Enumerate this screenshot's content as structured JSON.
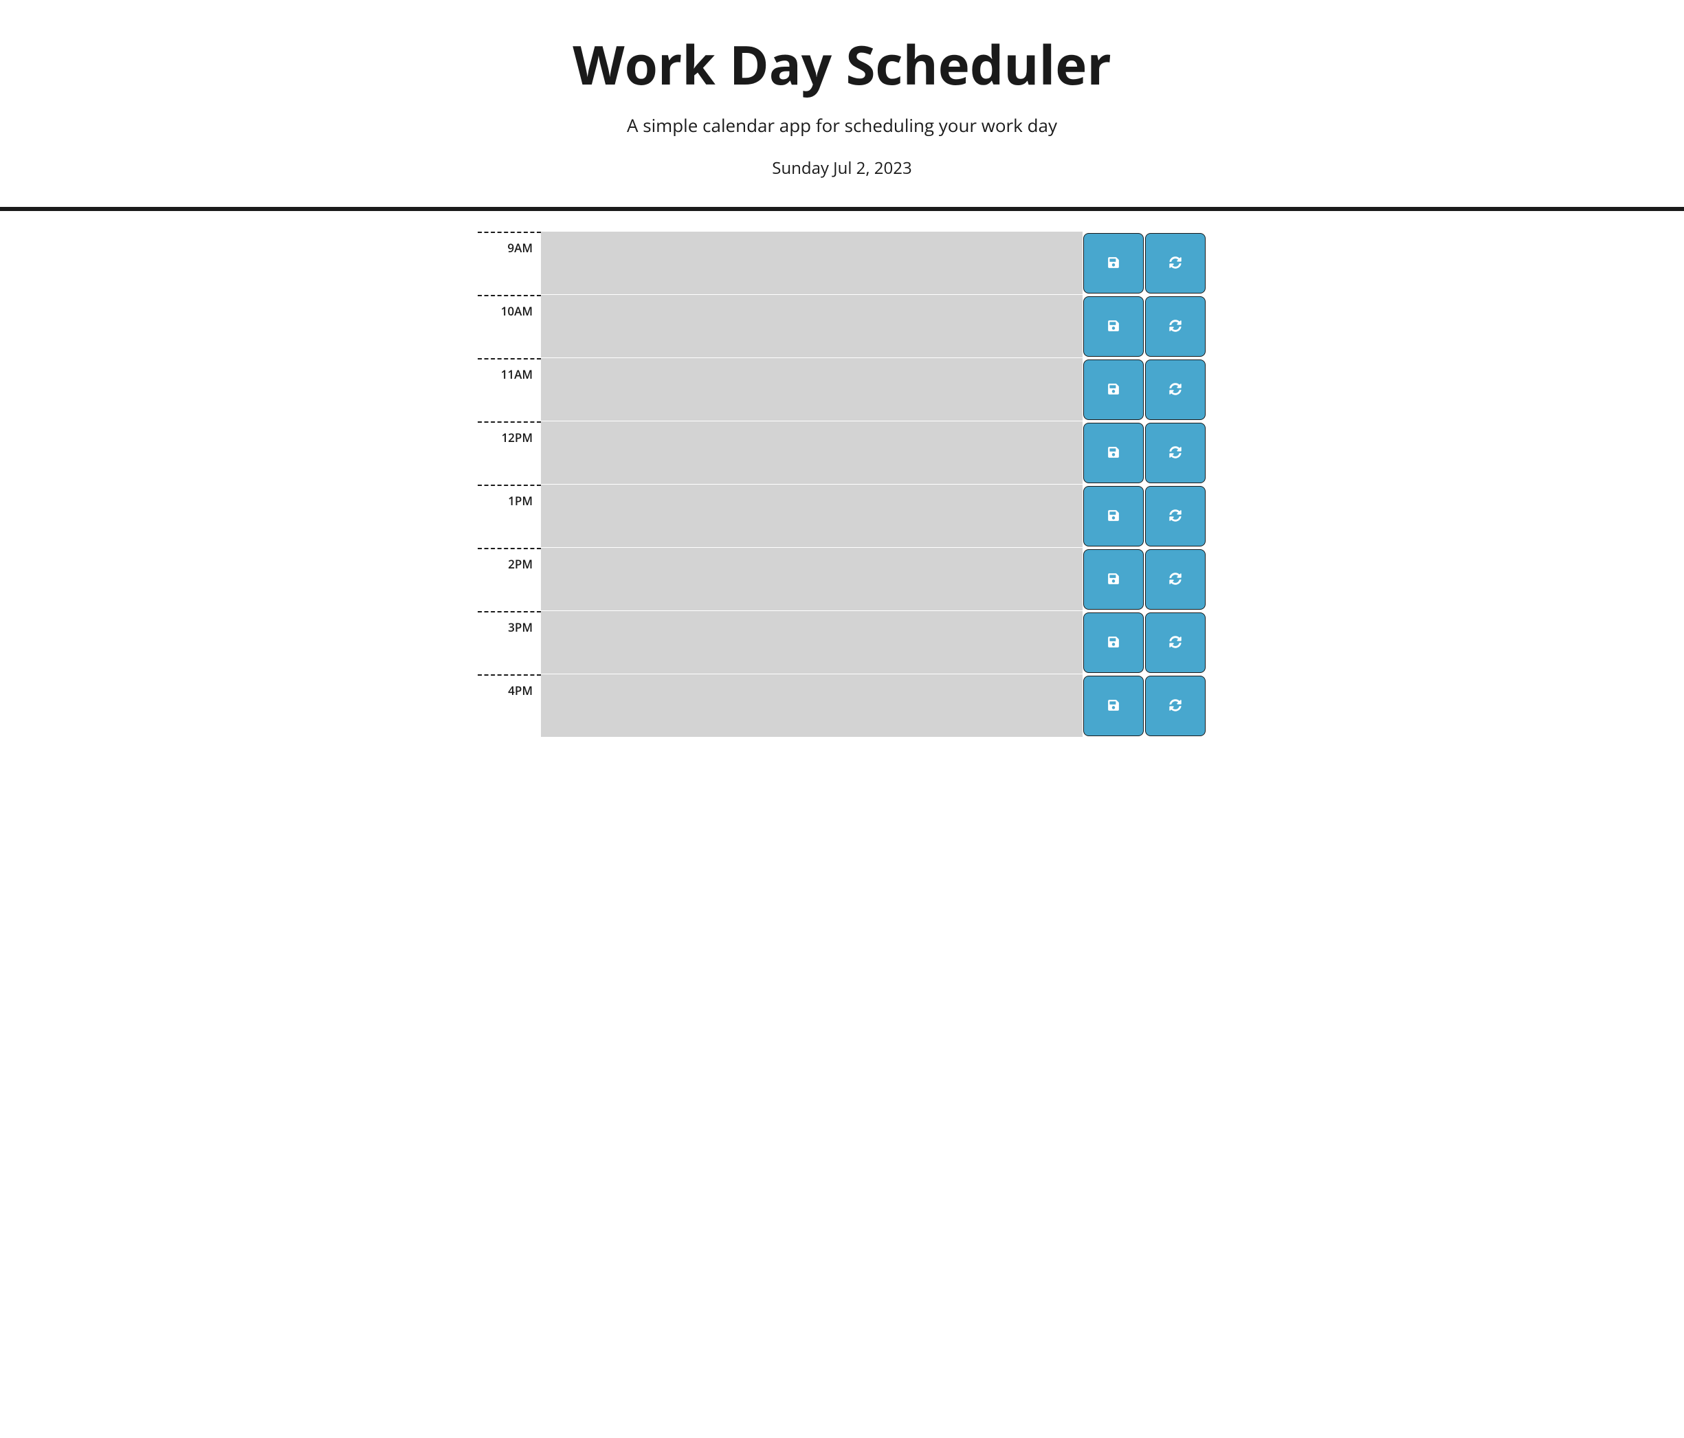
{
  "header": {
    "title": "Work Day Scheduler",
    "subtitle": "A simple calendar app for scheduling your work day",
    "currentDate": "Sunday Jul 2, 2023"
  },
  "timeBlocks": [
    {
      "label": "9AM",
      "value": ""
    },
    {
      "label": "10AM",
      "value": ""
    },
    {
      "label": "11AM",
      "value": ""
    },
    {
      "label": "12PM",
      "value": ""
    },
    {
      "label": "1PM",
      "value": ""
    },
    {
      "label": "2PM",
      "value": ""
    },
    {
      "label": "3PM",
      "value": ""
    },
    {
      "label": "4PM",
      "value": ""
    }
  ],
  "icons": {
    "save": "save-icon",
    "refresh": "refresh-icon"
  },
  "colors": {
    "buttonBg": "#48a7ce",
    "descriptionBg": "#d3d3d3",
    "border": "#1a1a1a"
  }
}
